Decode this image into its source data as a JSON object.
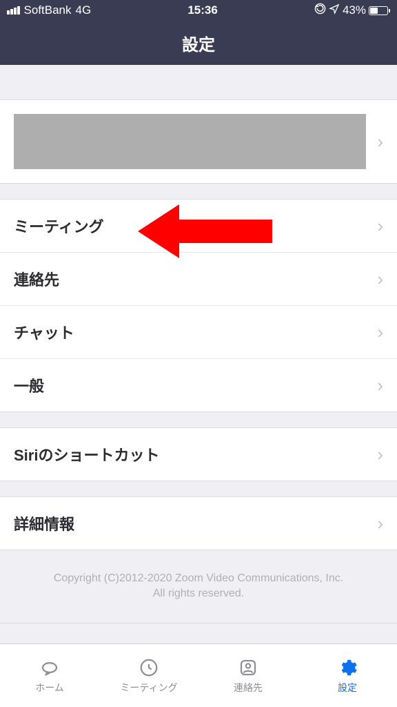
{
  "status_bar": {
    "carrier": "SoftBank",
    "network": "4G",
    "time": "15:36",
    "battery_percent": "43%"
  },
  "header": {
    "title": "設定"
  },
  "settings": {
    "group1": [
      {
        "label": "ミーティング"
      },
      {
        "label": "連絡先"
      },
      {
        "label": "チャット"
      },
      {
        "label": "一般"
      }
    ],
    "group2": [
      {
        "label": "Siriのショートカット"
      }
    ],
    "group3": [
      {
        "label": "詳細情報"
      }
    ]
  },
  "footer": {
    "copyright_line1": "Copyright (C)2012-2020 Zoom Video Communications, Inc.",
    "copyright_line2": "All rights reserved."
  },
  "tabs": {
    "home": "ホーム",
    "meeting": "ミーティング",
    "contacts": "連絡先",
    "settings": "設定"
  }
}
